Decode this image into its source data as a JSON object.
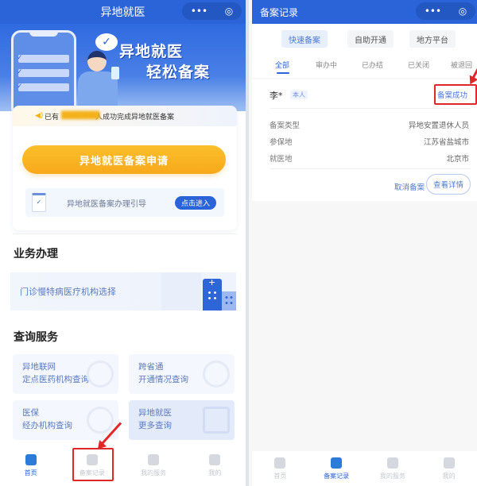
{
  "left_screen": {
    "title": "异地就医",
    "capsule": {
      "more_icon": "•••",
      "close_icon": "◎"
    },
    "banner": {
      "slogan_line1": "异地就医",
      "slogan_line2": "轻松备案",
      "check_icon": "✓"
    },
    "notice": {
      "speaker_icon": "◀)",
      "prefix": "已有",
      "count": "███████",
      "suffix": "人成功完成异地就医备案"
    },
    "apply_button": "异地就医备案申请",
    "guide": {
      "doc_icon": "✓",
      "label": "异地就医备案办理引导",
      "enter_button": "点击进入"
    },
    "business": {
      "title": "业务办理",
      "item": "门诊慢特病医疗机构选择"
    },
    "query": {
      "title": "查询服务",
      "items": [
        {
          "line1": "异地联网",
          "line2": "定点医药机构查询"
        },
        {
          "line1": "跨省通",
          "line2": "开通情况查询"
        },
        {
          "line1": "医保",
          "line2": "经办机构查询"
        },
        {
          "line1": "异地就医",
          "line2": "更多查询"
        }
      ]
    },
    "tabbar": [
      {
        "label": "首页",
        "active": true
      },
      {
        "label": "备案记录",
        "active": false
      },
      {
        "label": "我的服务",
        "active": false
      },
      {
        "label": "我的",
        "active": false
      }
    ]
  },
  "right_screen": {
    "title": "备案记录",
    "capsule": {
      "more_icon": "•••",
      "close_icon": "◎"
    },
    "chips": [
      {
        "label": "快速备案",
        "active": true
      },
      {
        "label": "自助开通",
        "active": false
      },
      {
        "label": "地方平台",
        "active": false
      }
    ],
    "status_tabs": [
      {
        "label": "全部",
        "active": true
      },
      {
        "label": "审办中",
        "active": false
      },
      {
        "label": "已办结",
        "active": false
      },
      {
        "label": "已关闭",
        "active": false
      },
      {
        "label": "被退回",
        "active": false
      }
    ],
    "record": {
      "name": "李*",
      "tag": "本人",
      "status": "备案成功",
      "fields": [
        {
          "key": "备案类型",
          "value": "异地安置退休人员"
        },
        {
          "key": "参保地",
          "value": "江苏省盐城市"
        },
        {
          "key": "就医地",
          "value": "北京市"
        }
      ],
      "cancel_button": "取消备案",
      "detail_button": "查看详情"
    },
    "tabbar": [
      {
        "label": "首页",
        "active": false
      },
      {
        "label": "备案记录",
        "active": true
      },
      {
        "label": "我的服务",
        "active": false
      },
      {
        "label": "我的",
        "active": false
      }
    ]
  },
  "colors": {
    "primary": "#2b64d8",
    "apply_button": "#f7a91b",
    "highlight_red": "#e02828"
  }
}
